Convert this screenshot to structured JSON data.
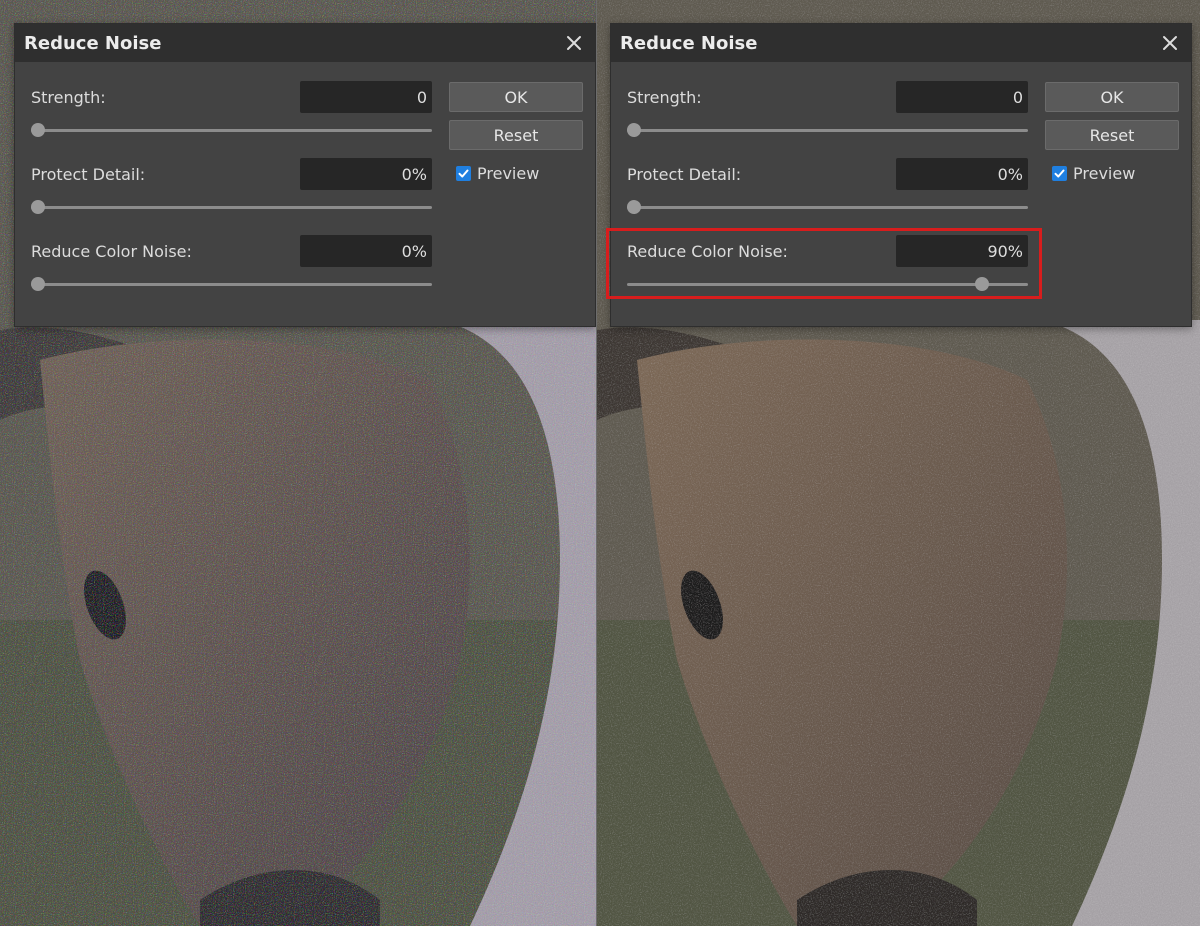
{
  "left_dialog": {
    "title": "Reduce Noise",
    "strength": {
      "label": "Strength:",
      "value": "0",
      "slider_fraction": 0
    },
    "protect_detail": {
      "label": "Protect Detail:",
      "value": "0%",
      "slider_fraction": 0
    },
    "reduce_color_noise": {
      "label": "Reduce Color Noise:",
      "value": "0%",
      "slider_fraction": 0
    },
    "ok_label": "OK",
    "reset_label": "Reset",
    "preview_label": "Preview",
    "preview_checked": true
  },
  "right_dialog": {
    "title": "Reduce Noise",
    "strength": {
      "label": "Strength:",
      "value": "0",
      "slider_fraction": 0
    },
    "protect_detail": {
      "label": "Protect Detail:",
      "value": "0%",
      "slider_fraction": 0
    },
    "reduce_color_noise": {
      "label": "Reduce Color Noise:",
      "value": "90%",
      "slider_fraction": 0.9
    },
    "ok_label": "OK",
    "reset_label": "Reset",
    "preview_label": "Preview",
    "preview_checked": true
  },
  "colors": {
    "dialog_bg": "#434343",
    "titlebar_bg": "#2f2f2f",
    "field_bg": "#262626",
    "checkbox_accent": "#1f7fe0",
    "highlight_outline": "#d81d1d"
  },
  "icons": {
    "close": "close-icon",
    "check": "checkmark-icon"
  }
}
